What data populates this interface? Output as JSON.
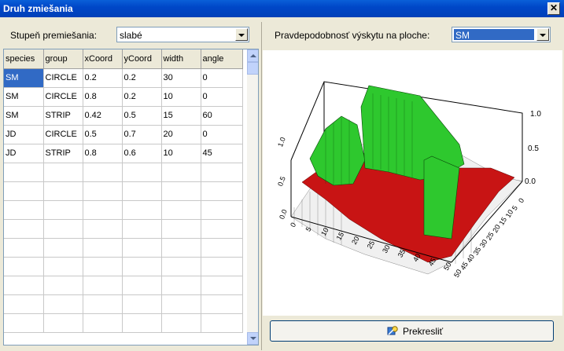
{
  "window": {
    "title": "Druh zmiešania",
    "close_glyph": "✕"
  },
  "mixing": {
    "label": "Stupeň premiešania:",
    "value": "slabé"
  },
  "probability": {
    "label": "Pravdepodobnosť výskytu  na ploche:",
    "value": "SM"
  },
  "table": {
    "columns": [
      "species",
      "group",
      "xCoord",
      "yCoord",
      "width",
      "angle"
    ],
    "rows": [
      [
        "SM",
        "CIRCLE",
        "0.2",
        "0.2",
        "30",
        "0"
      ],
      [
        "SM",
        "CIRCLE",
        "0.8",
        "0.2",
        "10",
        "0"
      ],
      [
        "SM",
        "STRIP",
        "0.42",
        "0.5",
        "15",
        "60"
      ],
      [
        "JD",
        "CIRCLE",
        "0.5",
        "0.7",
        "20",
        "0"
      ],
      [
        "JD",
        "STRIP",
        "0.8",
        "0.6",
        "10",
        "45"
      ]
    ],
    "empty_rows": 9
  },
  "plot": {
    "z_ticks": [
      "1.0",
      "0.5",
      "0.0"
    ],
    "z_ticks_left": [
      "1.0",
      "0.5",
      "0.0"
    ],
    "x_ticks": [
      "0",
      "5",
      "10",
      "15",
      "20",
      "25",
      "30",
      "35",
      "40",
      "45",
      "50"
    ],
    "y_ticks": [
      "0",
      "5",
      "10",
      "15",
      "20",
      "25",
      "30",
      "35",
      "40",
      "45",
      "50"
    ],
    "colors": {
      "high": "#2ec82e",
      "mid": "#c81414",
      "low": "#f0f0f0"
    }
  },
  "redraw_button": {
    "label": "Prekresliť"
  }
}
